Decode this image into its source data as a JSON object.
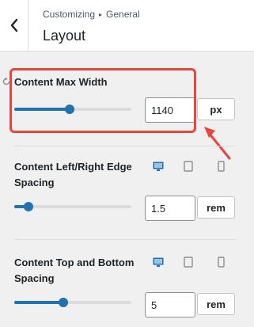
{
  "header": {
    "breadcrumb_parent": "Customizing",
    "breadcrumb_child": "General",
    "title": "Layout"
  },
  "controls": [
    {
      "title": "Content Max Width",
      "value": "1140",
      "unit": "px",
      "slider_fraction": 0.47
    },
    {
      "title_line1": "Content Left/Right Edge",
      "title_line2": "Spacing",
      "value": "1.5",
      "unit": "rem",
      "slider_fraction": 0.12,
      "devices": [
        "desktop-icon",
        "tablet-icon",
        "mobile-icon"
      ]
    },
    {
      "title_line1": "Content Top and Bottom",
      "title_line2": "Spacing",
      "value": "5",
      "unit": "rem",
      "slider_fraction": 0.42,
      "devices": [
        "desktop-icon",
        "tablet-icon",
        "mobile-icon"
      ]
    }
  ],
  "colors": {
    "accent": "#2271b1",
    "annotation": "#e8453c"
  }
}
